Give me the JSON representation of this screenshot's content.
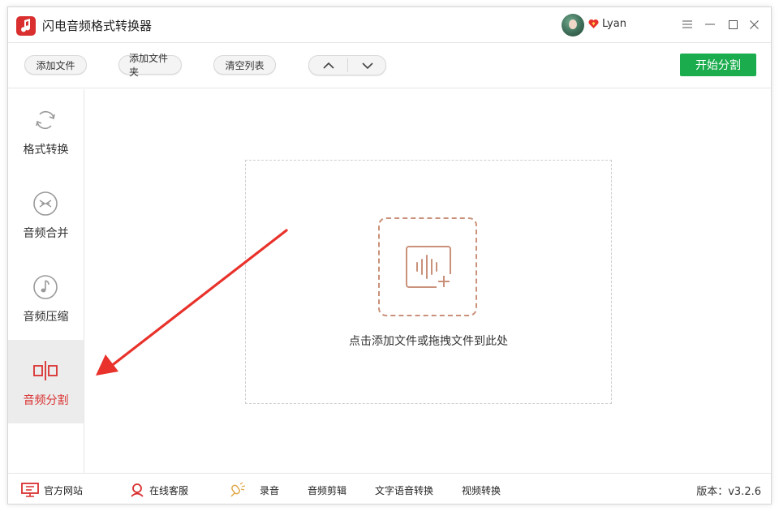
{
  "app": {
    "title": "闪电音频格式转换器"
  },
  "user": {
    "name": "Lyan"
  },
  "toolbar": {
    "add_file": "添加文件",
    "add_folder": "添加文件夹",
    "clear_list": "清空列表",
    "start": "开始分割"
  },
  "sidebar": {
    "items": [
      {
        "label": "格式转换",
        "icon": "refresh-icon"
      },
      {
        "label": "音频合并",
        "icon": "merge-icon"
      },
      {
        "label": "音频压缩",
        "icon": "music-note-icon"
      },
      {
        "label": "音频分割",
        "icon": "split-icon",
        "active": true
      }
    ]
  },
  "main": {
    "drop_text": "点击添加文件或拖拽文件到此处"
  },
  "footer": {
    "website": "官方网站",
    "support": "在线客服",
    "record": "录音",
    "audio_edit": "音频剪辑",
    "tts": "文字语音转换",
    "video_convert": "视频转换",
    "version": "版本：v3.2.6"
  },
  "colors": {
    "brand_red": "#d9302f",
    "start_green": "#1aac4d",
    "drop_accent": "#c9917a",
    "arrow_red": "#e8322b"
  }
}
